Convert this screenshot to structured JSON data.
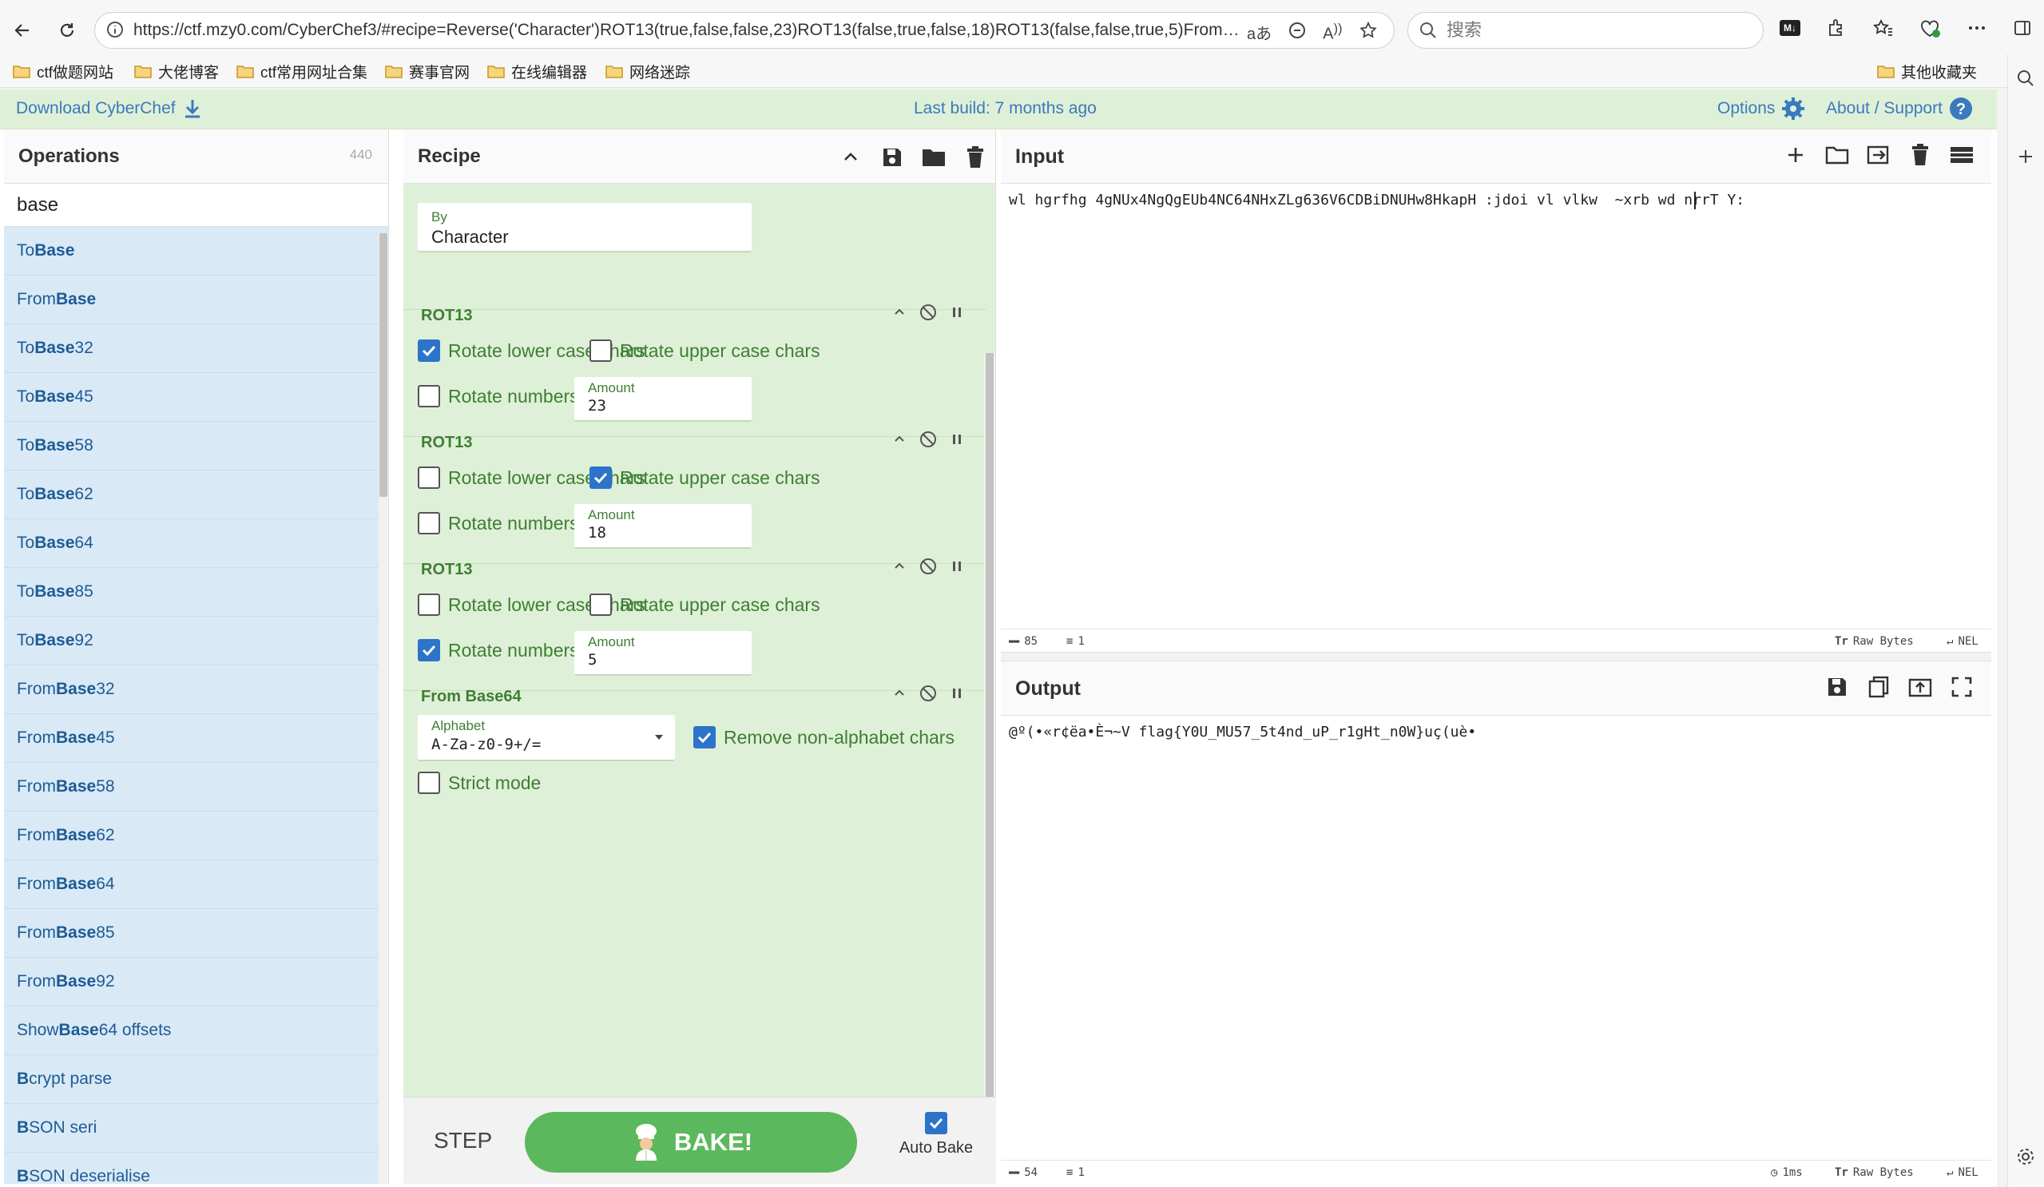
{
  "browser": {
    "url": "https://ctf.mzy0.com/CyberChef3/#recipe=Reverse('Character')ROT13(true,false,false,23)ROT13(false,true,false,18)ROT13(false,false,true,5)From_Base...",
    "search_placeholder": "搜索",
    "bookmarks": [
      "ctf做题网站",
      "大佬博客",
      "ctf常用网址合集",
      "赛事官网",
      "在线编辑器",
      "网络迷踪"
    ],
    "other_bookmarks": "其他收藏夹"
  },
  "banner": {
    "download": "Download CyberChef",
    "last_build": "Last build: 7 months ago",
    "options": "Options",
    "about": "About / Support"
  },
  "operations": {
    "title": "Operations",
    "count": "440",
    "search_value": "base",
    "items": [
      {
        "pre": "To ",
        "hl": "Base",
        "post": ""
      },
      {
        "pre": "From ",
        "hl": "Base",
        "post": ""
      },
      {
        "pre": "To ",
        "hl": "Base",
        "post": "32"
      },
      {
        "pre": "To ",
        "hl": "Base",
        "post": "45"
      },
      {
        "pre": "To ",
        "hl": "Base",
        "post": "58"
      },
      {
        "pre": "To ",
        "hl": "Base",
        "post": "62"
      },
      {
        "pre": "To ",
        "hl": "Base",
        "post": "64"
      },
      {
        "pre": "To ",
        "hl": "Base",
        "post": "85"
      },
      {
        "pre": "To ",
        "hl": "Base",
        "post": "92"
      },
      {
        "pre": "From ",
        "hl": "Base",
        "post": "32"
      },
      {
        "pre": "From ",
        "hl": "Base",
        "post": "45"
      },
      {
        "pre": "From ",
        "hl": "Base",
        "post": "58"
      },
      {
        "pre": "From ",
        "hl": "Base",
        "post": "62"
      },
      {
        "pre": "From ",
        "hl": "Base",
        "post": "64"
      },
      {
        "pre": "From ",
        "hl": "Base",
        "post": "85"
      },
      {
        "pre": "From ",
        "hl": "Base",
        "post": "92"
      },
      {
        "pre": "Show ",
        "hl": "Base",
        "post": "64 offsets"
      },
      {
        "pre": "",
        "hl": "B",
        "post": "crypt parse",
        "extra_hl": "ase"
      },
      {
        "pre": "",
        "hl": "B",
        "post": "SON seri",
        "extra_hl": "alise"
      },
      {
        "pre": "",
        "hl": "B",
        "post": "SON deserialise"
      }
    ]
  },
  "recipe": {
    "title": "Recipe",
    "reverse": {
      "by_label": "By",
      "by_value": "Character"
    },
    "rot13_a": {
      "name": "ROT13",
      "lower": "Rotate lower case chars",
      "upper": "Rotate upper case chars",
      "numbers": "Rotate numbers",
      "amount_label": "Amount",
      "amount": "23",
      "lower_checked": true,
      "upper_checked": false,
      "numbers_checked": false
    },
    "rot13_b": {
      "name": "ROT13",
      "lower": "Rotate lower case chars",
      "upper": "Rotate upper case chars",
      "numbers": "Rotate numbers",
      "amount_label": "Amount",
      "amount": "18",
      "lower_checked": false,
      "upper_checked": true,
      "numbers_checked": false
    },
    "rot13_c": {
      "name": "ROT13",
      "lower": "Rotate lower case chars",
      "upper": "Rotate upper case chars",
      "numbers": "Rotate numbers",
      "amount_label": "Amount",
      "amount": "5",
      "lower_checked": false,
      "upper_checked": false,
      "numbers_checked": true
    },
    "from_base64": {
      "name": "From Base64",
      "alphabet_label": "Alphabet",
      "alphabet": "A-Za-z0-9+/=",
      "remove_nonalpha": "Remove non-alphabet chars",
      "strict": "Strict mode",
      "remove_checked": true,
      "strict_checked": false
    }
  },
  "controls": {
    "step": "STEP",
    "bake": "BAKE!",
    "auto_bake": "Auto Bake",
    "auto_bake_checked": true
  },
  "input": {
    "title": "Input",
    "text": "wl hgrfhg 4gNUx4NgQgEUb4NC64NHxZLg636V6CDBiDNUHw8HkapH :jdoi vl vlkw  ~xrb wd nrrT Y:",
    "length": "85",
    "lines": "1",
    "encoding": "Raw Bytes",
    "eol": "NEL"
  },
  "output": {
    "title": "Output",
    "text": "@º(•«r¢ëa•È¬~V flag{Y0U_MU57_5t4nd_uP_r1gHt_n0W}uç(uè•",
    "length": "54",
    "lines": "1",
    "time": "1ms",
    "encoding": "Raw Bytes",
    "eol": "NEL"
  },
  "colors": {
    "green_bg": "#dff0d8",
    "op_blue": "#d9e9f6",
    "bake_green": "#5cb85c",
    "check_blue": "#2c74c9",
    "link_blue": "#3a7abd"
  }
}
